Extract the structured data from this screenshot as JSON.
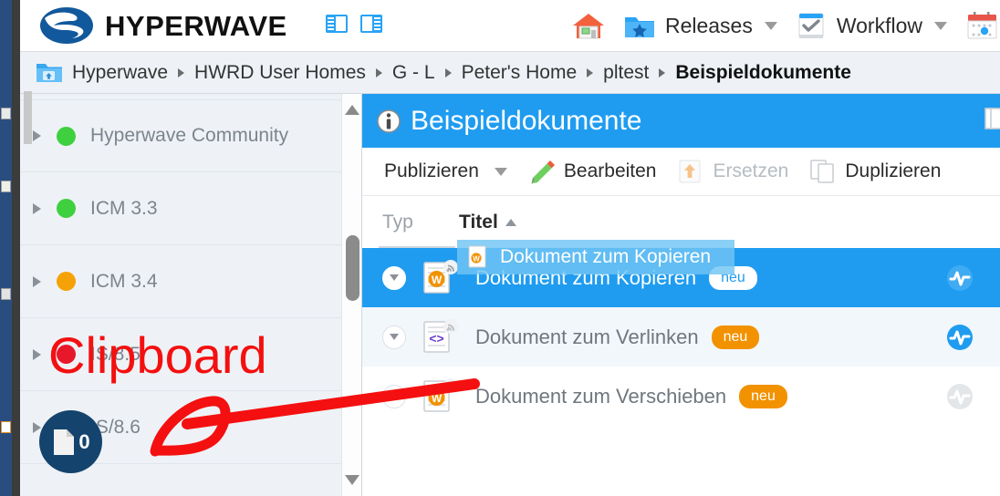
{
  "app": {
    "brand": "HYPERWAVE",
    "logo_color": "#12589c"
  },
  "header": {
    "panel_toggle_left": "panel-left-icon",
    "panel_toggle_right": "panel-right-icon",
    "items": [
      {
        "label": "",
        "icon": "home-icon",
        "has_caret": false
      },
      {
        "label": "Releases",
        "icon": "folder-star-icon",
        "has_caret": true
      },
      {
        "label": "Workflow",
        "icon": "checkbox-icon",
        "has_caret": true
      },
      {
        "label": "",
        "icon": "calendar-icon",
        "has_caret": false
      }
    ]
  },
  "breadcrumb": {
    "folder_icon": "folder-up-icon",
    "items": [
      "Hyperwave",
      "HWRD User Homes",
      "G - L",
      "Peter's Home",
      "pltest",
      "Beispieldokumente"
    ]
  },
  "sidebar": {
    "nodes": [
      {
        "label": "Hyperwave Community",
        "status_color": "#3fd03f"
      },
      {
        "label": "ICM 3.3",
        "status_color": "#3fd03f"
      },
      {
        "label": "ICM 3.4",
        "status_color": "#f5a208"
      },
      {
        "label": "IS/8.5",
        "status_color": "#e8182b"
      },
      {
        "label": "IS/8.6",
        "status_color": "#3fd03f"
      }
    ],
    "clipboard": {
      "count": "0",
      "icon": "document-icon",
      "badge_color": "#14446e"
    },
    "scrollbar": {
      "up_arrow": "scroll-up-arrow",
      "down_arrow": "scroll-down-arrow"
    }
  },
  "content": {
    "title": "Beispieldokumente",
    "title_icon": "info-icon",
    "title_bar_color": "#1f9cf0",
    "toolbar": [
      {
        "label": "Publizieren",
        "icon": "",
        "caret": true,
        "disabled": false
      },
      {
        "label": "Bearbeiten",
        "icon": "pencil-icon",
        "caret": false,
        "disabled": false
      },
      {
        "label": "Ersetzen",
        "icon": "upload-icon",
        "caret": false,
        "disabled": true
      },
      {
        "label": "Duplizieren",
        "icon": "copy-icon",
        "caret": false,
        "disabled": false
      }
    ],
    "table": {
      "columns": [
        {
          "key": "typ",
          "label": "Typ",
          "sorted": false
        },
        {
          "key": "titel",
          "label": "Titel",
          "sorted": true,
          "sort_dir": "asc"
        }
      ],
      "rows": [
        {
          "title": "Dokument zum Kopieren",
          "badge": "neu",
          "doc_type": "word",
          "selected": true,
          "pulse_state": "active-on-blue"
        },
        {
          "title": "Dokument zum Verlinken",
          "badge": "neu",
          "doc_type": "code",
          "selected": false,
          "pulse_state": "active"
        },
        {
          "title": "Dokument zum Verschieben",
          "badge": "neu",
          "doc_type": "word",
          "selected": false,
          "pulse_state": "inactive"
        }
      ]
    },
    "drag_ghost": {
      "label": "Dokument zum Kopieren",
      "icon": "word-document-icon"
    }
  },
  "annotation": {
    "label": "Clipboard",
    "color": "#f41010"
  }
}
